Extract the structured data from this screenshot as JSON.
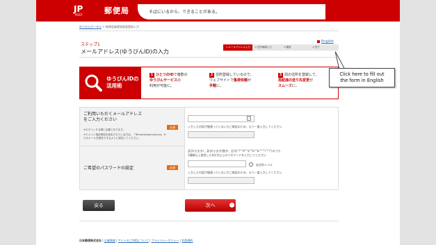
{
  "header": {
    "logo_text": "POST",
    "brand": "郵便局",
    "tagline": "そばにいるから、できることがある。"
  },
  "breadcrumb": {
    "home": "ゆうびんポータル",
    "current": "新規会員登録画面登録入力"
  },
  "step": {
    "label": "ステップ1",
    "title": "メールアドレス(ゆうびんID)の入力"
  },
  "progress": [
    "1.メールアドレス入力",
    "2.住所情報入力",
    "3.確認",
    "4.完了"
  ],
  "english_link": "English",
  "tooltip": {
    "line1": "Click here to fill out",
    "line2": "the form in English"
  },
  "banner": {
    "title_line1": "ゆうびんIDの",
    "title_line2": "活用術",
    "features": [
      {
        "num": "1",
        "line1_hl": "ひとつのID",
        "line1": "で複数の",
        "line2_hl": "ゆうびんサービス",
        "line2": "の",
        "line3": "利用が可能に。"
      },
      {
        "num": "2",
        "line1": "住所登録しているので、",
        "line2_pre": "ウェブサイトで",
        "line2_hl": "集荷依頼",
        "line2": "が",
        "line3_hl": "手軽",
        "line3": "に。"
      },
      {
        "num": "3",
        "line1": "別の住所を登録して、",
        "line2_hl": "再配達の送り先変更",
        "line2": "が",
        "line3_hl": "スムーズ",
        "line3": "に。"
      }
    ]
  },
  "form": {
    "email": {
      "title_line1": "ご利用いただくメールアドレス",
      "title_line2": "をご入力ください",
      "note1": "※ログインする際に必要となります。",
      "note2": "※ドメイン指定受信を設定されている方は、「@mpostjapanpost.jp」からのメールを受信できるように設定してください。",
      "required": "必須",
      "help": "入力した内容が間違っていないかご確認のため、もう一度入力してください"
    },
    "password": {
      "title": "ご希望のパスワードの設定",
      "required": "必須",
      "rule1": "英字(大文字)、英字(小文字)数字、記号(\"!\"\"#\"\"$\"\"%\"\"&\"\"'\"\"(\"\")\")のうち",
      "rule2": "2種類以上使用した8文字以上のパスワードを入力してください",
      "strength": "安全性レベル",
      "help": "入力した内容が間違っていないかご確認のため、もう一度入力してください"
    }
  },
  "buttons": {
    "back": "戻る",
    "next": "次へ"
  },
  "footer": {
    "company": "日本郵便株式会社",
    "links": [
      "企業情報",
      "サイトのご利用について",
      "プライバシーポリシー",
      "利用規約"
    ]
  },
  "colors": {
    "brand_red": "#cc0000",
    "link_blue": "#2a6cb8",
    "required_orange": "#e86a10"
  }
}
